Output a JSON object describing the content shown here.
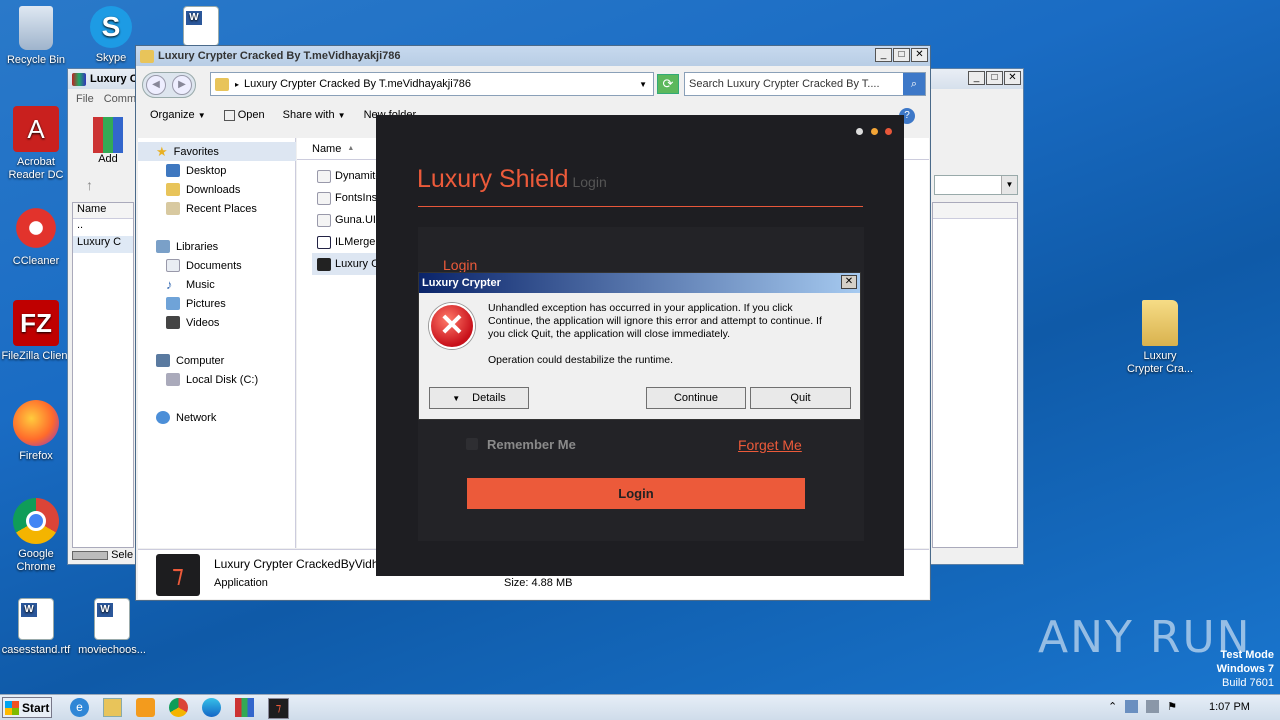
{
  "desktop_icons": [
    {
      "label": "Recycle Bin",
      "icon": "recycle-bin-icon"
    },
    {
      "label": "Skype",
      "icon": "skype-icon"
    },
    {
      "label": "Acrobat Reader DC",
      "icon": "acrobat-icon"
    },
    {
      "label": "CCleaner",
      "icon": "ccleaner-icon"
    },
    {
      "label": "FileZilla Client",
      "icon": "filezilla-icon"
    },
    {
      "label": "Firefox",
      "icon": "firefox-icon"
    },
    {
      "label": "Google Chrome",
      "icon": "chrome-icon"
    },
    {
      "label": "casesstand.rtf",
      "icon": "word-doc-icon"
    },
    {
      "label": "moviechoos...",
      "icon": "word-doc-icon"
    },
    {
      "label": "Luxury Crypter Cra...",
      "icon": "folder-icon"
    }
  ],
  "rar_window": {
    "title": "Luxury C",
    "menu": [
      "File",
      "Comm"
    ],
    "add_label": "Add",
    "col_name": "Name",
    "rows": [
      "..",
      "Luxury C"
    ],
    "status": "Sele"
  },
  "explorer": {
    "title": "Luxury Crypter Cracked By T.meVidhayakji786",
    "address": "Luxury Crypter Cracked By T.meVidhayakji786",
    "search_placeholder": "Search Luxury Crypter Cracked By T....",
    "toolbar": {
      "organize": "Organize",
      "open": "Open",
      "share": "Share with",
      "new_folder": "New folder"
    },
    "nav": {
      "favorites": "Favorites",
      "desktop": "Desktop",
      "downloads": "Downloads",
      "recent": "Recent Places",
      "libraries": "Libraries",
      "documents": "Documents",
      "music": "Music",
      "pictures": "Pictures",
      "videos": "Videos",
      "computer": "Computer",
      "local_disk": "Local Disk (C:)",
      "network": "Network"
    },
    "col_name": "Name",
    "files": [
      "Dynamite",
      "FontsIns",
      "Guna.UI2",
      "ILMerge.",
      "Luxury C"
    ],
    "details": {
      "name": "Luxury Crypter CrackedByVidh",
      "type": "Application",
      "size": "Size: 4.88 MB"
    }
  },
  "luxury": {
    "title": "Luxury Shield",
    "subtitle": "Login",
    "login_heading": "Login",
    "remember": "Remember Me",
    "forget": "Forget Me",
    "login_button": "Login"
  },
  "dialog": {
    "title": "Luxury Crypter",
    "message": "Unhandled exception has occurred in your application. If you click Continue, the application will ignore this error and attempt to continue. If you click Quit, the application will close immediately.",
    "message2": "Operation could destabilize the runtime.",
    "details": "Details",
    "continue": "Continue",
    "quit": "Quit"
  },
  "watermark": {
    "text": "ANY RUN",
    "mode": "Test Mode",
    "os": "Windows 7",
    "build": "Build 7601"
  },
  "taskbar": {
    "start": "Start",
    "time": "1:07 PM"
  }
}
